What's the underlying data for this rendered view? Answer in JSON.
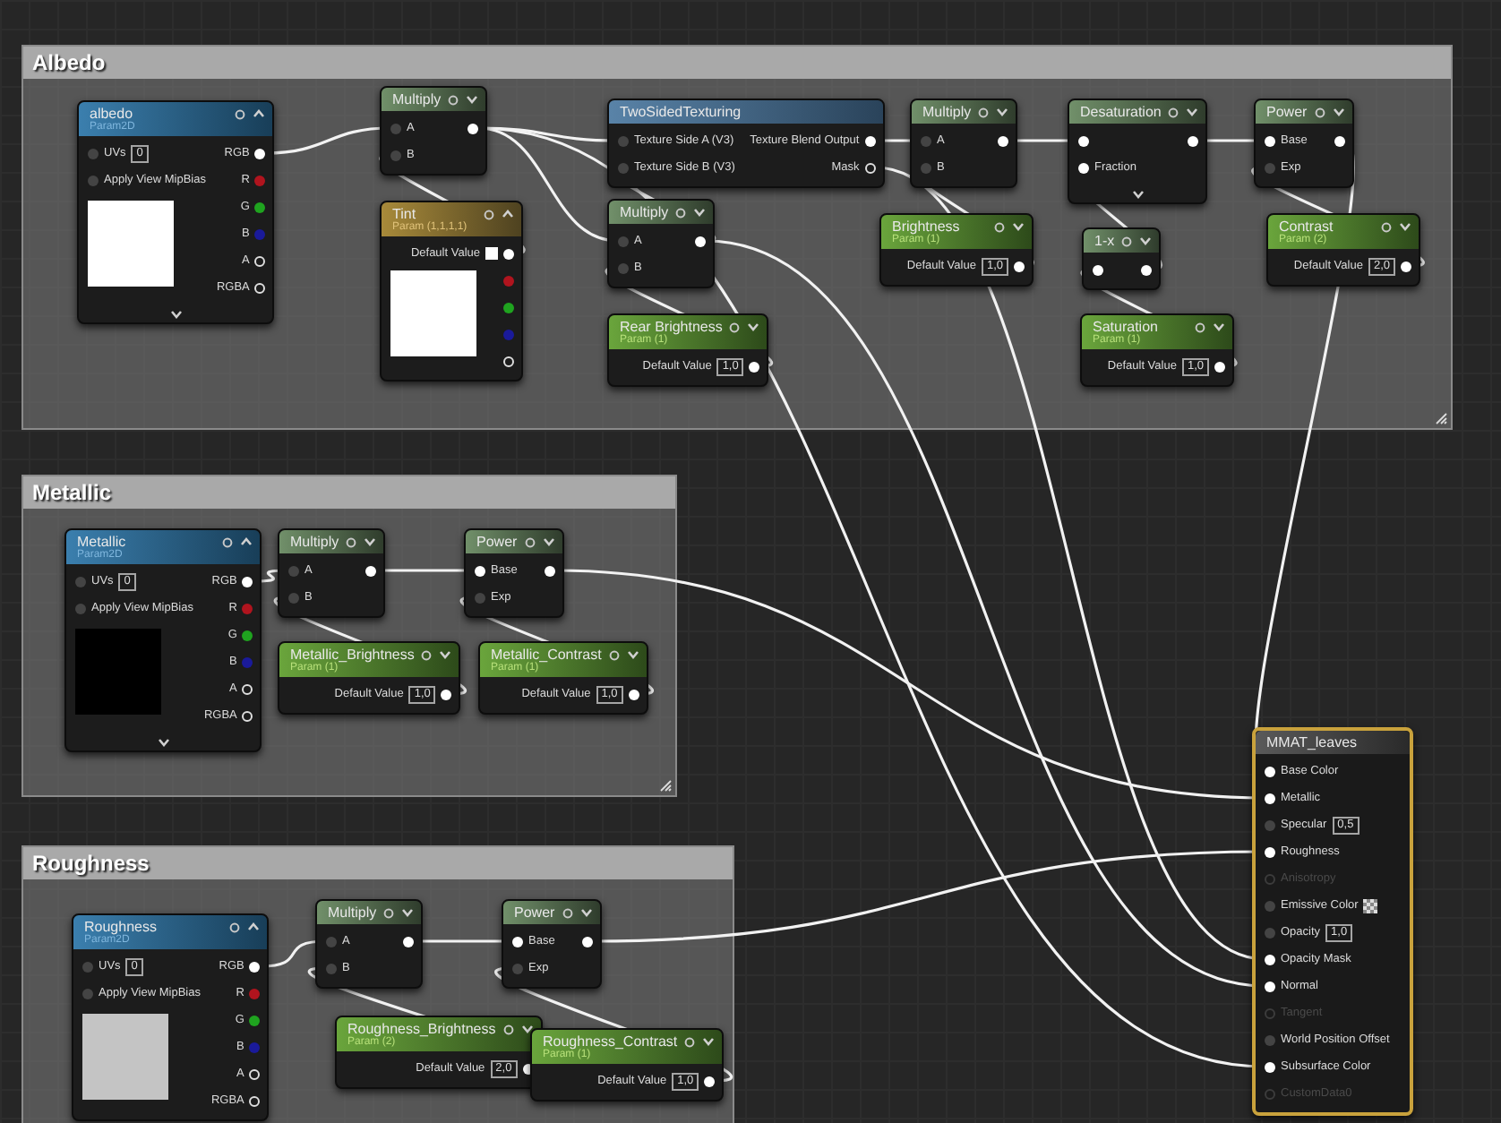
{
  "comments": [
    {
      "title": "Albedo"
    },
    {
      "title": "Metallic"
    },
    {
      "title": "Roughness"
    }
  ],
  "nodes": [
    {
      "kind": "texture",
      "title": "albedo",
      "subtitle": "Param2D",
      "expanded": false,
      "color": "#ffffff",
      "inputs": [
        {
          "label": "UVs",
          "value": "0",
          "linked": false
        },
        {
          "label": "Apply View MipBias",
          "linked": false
        }
      ],
      "outputs": [
        {
          "label": "RGB",
          "linked": true
        },
        {
          "label": "R",
          "color": "#b0141e"
        },
        {
          "label": "G",
          "color": "#1fa31f"
        },
        {
          "label": "B",
          "color": "#1a1a9a"
        },
        {
          "label": "A",
          "linked": false
        },
        {
          "label": "RGBA",
          "linked": false
        }
      ]
    },
    {
      "kind": "math",
      "title": "Multiply",
      "inputs": [
        {
          "label": "A",
          "linked": false
        },
        {
          "label": "B",
          "linked": false
        }
      ],
      "outputs": [
        {
          "linked": true
        }
      ]
    },
    {
      "kind": "vector",
      "title": "Tint",
      "subtitle": "Param (1,1,1,1)",
      "field": "Default Value",
      "color": "#ffffff",
      "outputs": [
        {
          "linked": true
        },
        {
          "color": "#b0141e"
        },
        {
          "color": "#1fa31f"
        },
        {
          "color": "#1a1a9a"
        },
        {
          "linked": false
        }
      ]
    },
    {
      "kind": "function",
      "title": "TwoSidedTexturing",
      "inputs": [
        {
          "label": "Texture Side A (V3)",
          "linked": false
        },
        {
          "label": "Texture Side B (V3)",
          "linked": false
        }
      ],
      "outputs": [
        {
          "label": "Texture Blend Output",
          "linked": true
        },
        {
          "label": "Mask",
          "linked": false
        }
      ]
    },
    {
      "kind": "math",
      "title": "Multiply",
      "inputs": [
        {
          "label": "A",
          "linked": false
        },
        {
          "label": "B",
          "linked": false
        }
      ],
      "outputs": [
        {
          "linked": true
        }
      ]
    },
    {
      "kind": "scalar",
      "title": "Rear Brightness",
      "subtitle": "Param (1)",
      "field": "Default Value",
      "value": "1,0",
      "outputs": [
        {
          "linked": true
        }
      ]
    },
    {
      "kind": "math",
      "title": "Multiply",
      "inputs": [
        {
          "label": "A",
          "linked": false
        },
        {
          "label": "B",
          "linked": false
        }
      ],
      "outputs": [
        {
          "linked": true
        }
      ]
    },
    {
      "kind": "scalar",
      "title": "Brightness",
      "subtitle": "Param (1)",
      "field": "Default Value",
      "value": "1,0",
      "outputs": [
        {
          "linked": true
        }
      ]
    },
    {
      "kind": "math",
      "title": "Desaturation",
      "expanded": false,
      "inputs": [
        {
          "linked": true
        },
        {
          "label": "Fraction",
          "linked": true
        }
      ],
      "outputs": [
        {
          "linked": true
        }
      ]
    },
    {
      "kind": "math",
      "title": "1-x",
      "inputs": [
        {
          "linked": true
        }
      ],
      "outputs": [
        {
          "linked": true
        }
      ]
    },
    {
      "kind": "scalar",
      "title": "Saturation",
      "subtitle": "Param (1)",
      "field": "Default Value",
      "value": "1,0",
      "outputs": [
        {
          "linked": true
        }
      ]
    },
    {
      "kind": "math",
      "title": "Power",
      "inputs": [
        {
          "label": "Base",
          "linked": true
        },
        {
          "label": "Exp",
          "linked": false
        }
      ],
      "outputs": [
        {
          "linked": true
        }
      ]
    },
    {
      "kind": "scalar",
      "title": "Contrast",
      "subtitle": "Param (2)",
      "field": "Default Value",
      "value": "2,0",
      "outputs": [
        {
          "linked": true
        }
      ]
    },
    {
      "kind": "texture",
      "title": "Metallic",
      "subtitle": "Param2D",
      "expanded": false,
      "color": "#000000",
      "inputs": [
        {
          "label": "UVs",
          "value": "0",
          "linked": false
        },
        {
          "label": "Apply View MipBias",
          "linked": false
        }
      ],
      "outputs": [
        {
          "label": "RGB",
          "linked": true
        },
        {
          "label": "R",
          "color": "#b0141e"
        },
        {
          "label": "G",
          "color": "#1fa31f"
        },
        {
          "label": "B",
          "color": "#1a1a9a"
        },
        {
          "label": "A",
          "linked": false
        },
        {
          "label": "RGBA",
          "linked": false
        }
      ]
    },
    {
      "kind": "math",
      "title": "Multiply",
      "inputs": [
        {
          "label": "A",
          "linked": false
        },
        {
          "label": "B",
          "linked": false
        }
      ],
      "outputs": [
        {
          "linked": true
        }
      ]
    },
    {
      "kind": "math",
      "title": "Power",
      "inputs": [
        {
          "label": "Base",
          "linked": true
        },
        {
          "label": "Exp",
          "linked": false
        }
      ],
      "outputs": [
        {
          "linked": true
        }
      ]
    },
    {
      "kind": "scalar",
      "title": "Metallic_Brightness",
      "subtitle": "Param (1)",
      "field": "Default Value",
      "value": "1,0",
      "outputs": [
        {
          "linked": true
        }
      ]
    },
    {
      "kind": "scalar",
      "title": "Metallic_Contrast",
      "subtitle": "Param (1)",
      "field": "Default Value",
      "value": "1,0",
      "outputs": [
        {
          "linked": true
        }
      ]
    },
    {
      "kind": "texture",
      "title": "Roughness",
      "subtitle": "Param2D",
      "color": "#c4c4c4",
      "inputs": [
        {
          "label": "UVs",
          "value": "0",
          "linked": false
        },
        {
          "label": "Apply View MipBias",
          "linked": false
        }
      ],
      "outputs": [
        {
          "label": "RGB",
          "linked": true
        },
        {
          "label": "R",
          "color": "#b0141e"
        },
        {
          "label": "G",
          "color": "#1fa31f"
        },
        {
          "label": "B",
          "color": "#1a1a9a"
        },
        {
          "label": "A",
          "linked": false
        },
        {
          "label": "RGBA",
          "linked": false
        }
      ]
    },
    {
      "kind": "math",
      "title": "Multiply",
      "inputs": [
        {
          "label": "A",
          "linked": false
        },
        {
          "label": "B",
          "linked": false
        }
      ],
      "outputs": [
        {
          "linked": true
        }
      ]
    },
    {
      "kind": "math",
      "title": "Power",
      "inputs": [
        {
          "label": "Base",
          "linked": true
        },
        {
          "label": "Exp",
          "linked": false
        }
      ],
      "outputs": [
        {
          "linked": true
        }
      ]
    },
    {
      "kind": "scalar",
      "title": "Roughness_Brightness",
      "subtitle": "Param (2)",
      "field": "Default Value",
      "value": "2,0",
      "outputs": [
        {
          "linked": true
        }
      ]
    },
    {
      "kind": "scalar",
      "title": "Roughness_Contrast",
      "subtitle": "Param (1)",
      "field": "Default Value",
      "value": "1,0",
      "outputs": [
        {
          "linked": true
        }
      ]
    },
    {
      "kind": "result",
      "title": "MMAT_leaves",
      "inputs": [
        {
          "label": "Base Color",
          "linked": true,
          "disabled": false
        },
        {
          "label": "Metallic",
          "linked": true,
          "disabled": false
        },
        {
          "label": "Specular",
          "value": "0,5",
          "linked": false,
          "disabled": false
        },
        {
          "label": "Roughness",
          "linked": true,
          "disabled": false
        },
        {
          "label": "Anisotropy",
          "linked": false,
          "disabled": true
        },
        {
          "label": "Emissive Color",
          "checker": true,
          "linked": false,
          "disabled": false
        },
        {
          "label": "Opacity",
          "value": "1,0",
          "linked": false,
          "disabled": false
        },
        {
          "label": "Opacity Mask",
          "linked": true,
          "disabled": false
        },
        {
          "label": "Normal",
          "linked": true,
          "disabled": false
        },
        {
          "label": "Tangent",
          "linked": false,
          "disabled": true
        },
        {
          "label": "World Position Offset",
          "linked": false,
          "disabled": false
        },
        {
          "label": "Subsurface Color",
          "linked": true,
          "disabled": false
        },
        {
          "label": "CustomData0",
          "linked": false,
          "disabled": true
        }
      ]
    }
  ]
}
